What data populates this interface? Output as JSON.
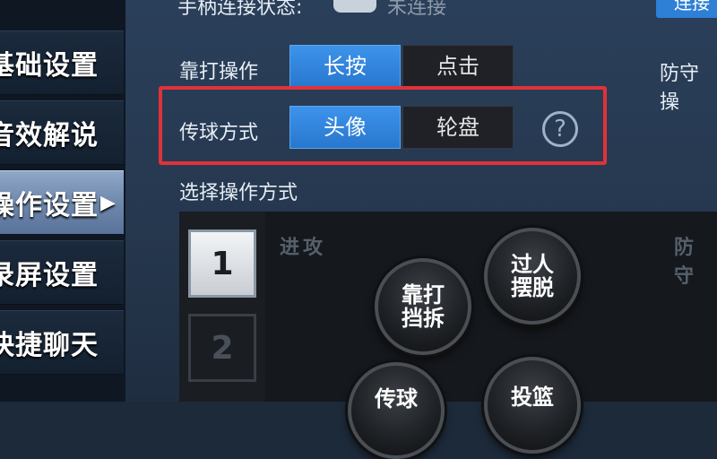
{
  "sidebar": {
    "items": [
      {
        "label": "基础设置"
      },
      {
        "label": "音效解说"
      },
      {
        "label": "操作设置",
        "active": true
      },
      {
        "label": "录屏设置"
      },
      {
        "label": "快捷聊天"
      }
    ],
    "active_arrow": "▶"
  },
  "connection": {
    "label": "手柄连接状态:",
    "status": "未连接",
    "button": "连接",
    "icon": "gamepad-icon"
  },
  "post_up": {
    "label": "靠打操作",
    "options": [
      "长按",
      "点击"
    ],
    "selected": 0,
    "side_label": "防守操"
  },
  "pass_mode": {
    "label": "传球方式",
    "options": [
      "头像",
      "轮盘"
    ],
    "selected": 0,
    "help_icon": "?",
    "highlight_color": "#e0323a"
  },
  "scheme": {
    "title": "选择操作方式",
    "buttons": [
      "1",
      "2"
    ],
    "selected": 0,
    "attack_label": "进攻",
    "defense_label": "防守",
    "skills": [
      "靠打\n挡拆",
      "过人\n摆脱",
      "传球",
      "投篮"
    ]
  },
  "colors": {
    "accent": "#2e7fd6",
    "background": "#26384f"
  }
}
